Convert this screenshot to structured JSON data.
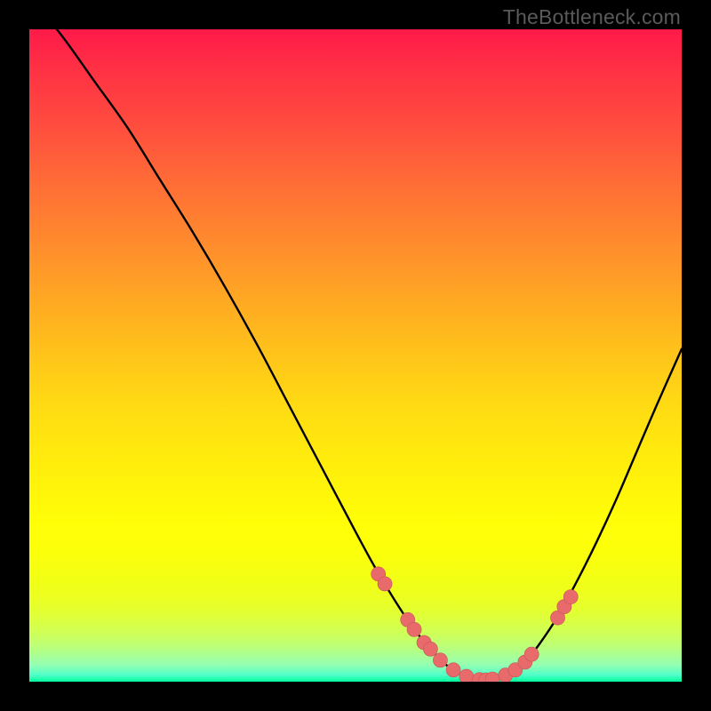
{
  "watermark": "TheBottleneck.com",
  "colors": {
    "frame": "#000000",
    "curve": "#000000",
    "marker_fill": "#e96a6a",
    "marker_stroke": "#c45656"
  },
  "chart_data": {
    "type": "line",
    "title": "",
    "xlabel": "",
    "ylabel": "",
    "xlim": [
      0,
      100
    ],
    "ylim": [
      0,
      100
    ],
    "curve": {
      "x": [
        0,
        5,
        10,
        15,
        20,
        25,
        30,
        35,
        40,
        45,
        50,
        53,
        56,
        59,
        62,
        64,
        66,
        68,
        70,
        72,
        74,
        76,
        78,
        81,
        84,
        87,
        90,
        93,
        96,
        100
      ],
      "y": [
        105,
        99,
        92,
        85,
        77,
        69,
        60.5,
        51.5,
        42,
        32.5,
        23,
        17.5,
        12.5,
        8,
        4.5,
        2.5,
        1.2,
        0.5,
        0.2,
        0.5,
        1.3,
        3,
        5.5,
        10,
        15.5,
        21.5,
        28,
        35,
        42,
        51
      ]
    },
    "markers": {
      "x": [
        53.5,
        54.5,
        58,
        59,
        60.5,
        61.5,
        63,
        65,
        67,
        69,
        70,
        71,
        73,
        74.5,
        76,
        77,
        81,
        82,
        83
      ],
      "y": [
        16.5,
        15,
        9.5,
        8,
        6,
        5,
        3.3,
        1.8,
        0.8,
        0.3,
        0.25,
        0.4,
        1,
        1.8,
        3,
        4.2,
        9.8,
        11.5,
        13
      ]
    },
    "marker_radius": 1.1
  }
}
